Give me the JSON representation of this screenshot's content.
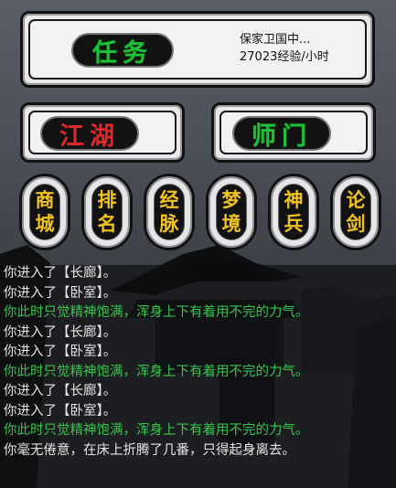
{
  "top_panel": {
    "quest_button": "任务",
    "quest_status": "保家卫国中...",
    "quest_rate": "27023经验/小时"
  },
  "mid_buttons": {
    "jianghu": "江湖",
    "shimen": "师门"
  },
  "nav_buttons": [
    {
      "chars": [
        "商",
        "城"
      ]
    },
    {
      "chars": [
        "排",
        "名"
      ]
    },
    {
      "chars": [
        "经",
        "脉"
      ]
    },
    {
      "chars": [
        "梦",
        "境"
      ]
    },
    {
      "chars": [
        "神",
        "兵"
      ]
    },
    {
      "chars": [
        "论",
        "剑"
      ]
    }
  ],
  "log": [
    {
      "text": "你进入了【长廊】。",
      "color": "white"
    },
    {
      "text": "你进入了【卧室】。",
      "color": "white"
    },
    {
      "text": "你此时只觉精神饱满，浑身上下有着用不完的力气。",
      "color": "green"
    },
    {
      "text": "你进入了【长廊】。",
      "color": "white"
    },
    {
      "text": "你进入了【卧室】。",
      "color": "white"
    },
    {
      "text": "你此时只觉精神饱满，浑身上下有着用不完的力气。",
      "color": "green"
    },
    {
      "text": "你进入了【长廊】。",
      "color": "white"
    },
    {
      "text": "你进入了【卧室】。",
      "color": "white"
    },
    {
      "text": "你此时只觉精神饱满，浑身上下有着用不完的力气。",
      "color": "green"
    },
    {
      "text": "你毫无倦意，在床上折腾了几番，只得起身离去。",
      "color": "white"
    }
  ],
  "colors": {
    "green_text": "#35c64b",
    "white_text": "#e6e6e6",
    "gold": "#f0c21e",
    "red": "#e0282c"
  }
}
